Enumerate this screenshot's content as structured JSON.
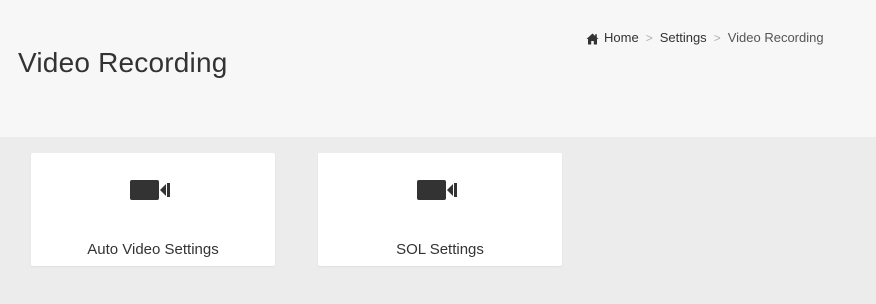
{
  "header": {
    "title": "Video Recording"
  },
  "breadcrumb": {
    "items": [
      {
        "label": "Home",
        "icon": "home-icon"
      },
      {
        "label": "Settings"
      },
      {
        "label": "Video Recording"
      }
    ],
    "separator": ">"
  },
  "cards": [
    {
      "label": "Auto Video Settings",
      "icon": "video-camera-icon"
    },
    {
      "label": "SOL Settings",
      "icon": "video-camera-icon"
    }
  ],
  "colors": {
    "header_bg": "#f7f7f7",
    "content_bg": "#ececec",
    "card_bg": "#ffffff",
    "icon": "#333333",
    "text": "#333333"
  }
}
